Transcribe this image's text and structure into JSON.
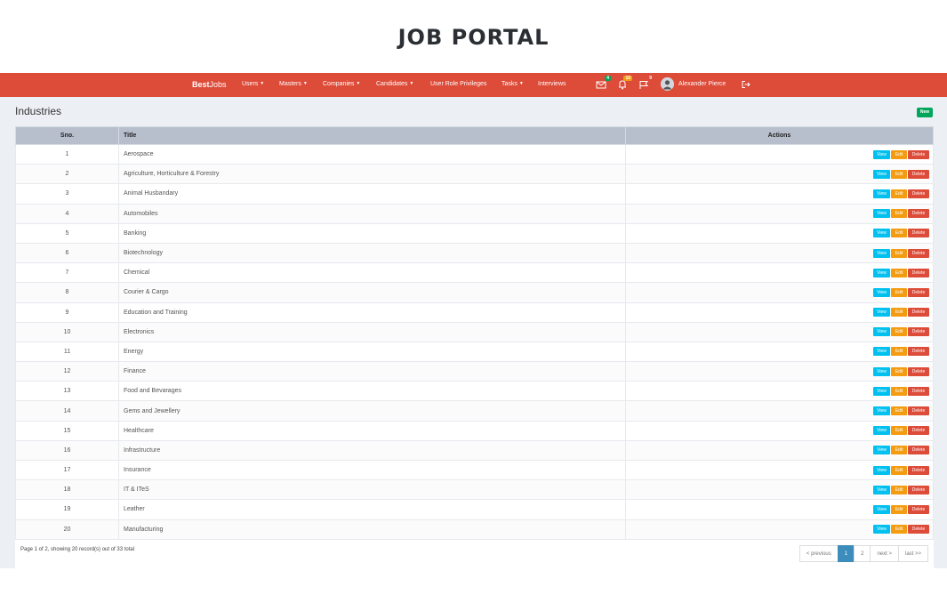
{
  "page_heading": "JOB PORTAL",
  "navbar": {
    "brand_bold": "Best",
    "brand_light": "Jobs",
    "items": [
      {
        "label": "Users",
        "dropdown": true
      },
      {
        "label": "Masters",
        "dropdown": true
      },
      {
        "label": "Companies",
        "dropdown": true
      },
      {
        "label": "Candidates",
        "dropdown": true
      },
      {
        "label": "User Role Privileges",
        "dropdown": false
      },
      {
        "label": "Tasks",
        "dropdown": true
      },
      {
        "label": "Interviews",
        "dropdown": false
      }
    ],
    "mail_badge": "4",
    "bell_badge": "10",
    "flag_badge": "9",
    "user_name": "Alexander Pierce"
  },
  "section": {
    "title": "Industries",
    "new_label": "New"
  },
  "table": {
    "headers": {
      "sno": "Sno.",
      "title": "Title",
      "actions": "Actions"
    },
    "action_labels": {
      "view": "View",
      "edit": "Edit",
      "delete": "Delete"
    },
    "rows": [
      {
        "sno": "1",
        "title": "Aerospace"
      },
      {
        "sno": "2",
        "title": "Agriculture, Horticulture & Forestry"
      },
      {
        "sno": "3",
        "title": "Animal Husbandary"
      },
      {
        "sno": "4",
        "title": "Automobiles"
      },
      {
        "sno": "5",
        "title": "Banking"
      },
      {
        "sno": "6",
        "title": "Biotechnology"
      },
      {
        "sno": "7",
        "title": "Chemical"
      },
      {
        "sno": "8",
        "title": "Courier & Cargo"
      },
      {
        "sno": "9",
        "title": "Education and Training"
      },
      {
        "sno": "10",
        "title": "Electronics"
      },
      {
        "sno": "11",
        "title": "Energy"
      },
      {
        "sno": "12",
        "title": "Finance"
      },
      {
        "sno": "13",
        "title": "Food and Bevarages"
      },
      {
        "sno": "14",
        "title": "Gems and Jewellery"
      },
      {
        "sno": "15",
        "title": "Healthcare"
      },
      {
        "sno": "16",
        "title": "Infrastructure"
      },
      {
        "sno": "17",
        "title": "Insurance"
      },
      {
        "sno": "18",
        "title": "IT & ITeS"
      },
      {
        "sno": "19",
        "title": "Leather"
      },
      {
        "sno": "20",
        "title": "Manufacturing"
      }
    ]
  },
  "footer": {
    "summary": "Page 1 of 2, showing 20 record(s) out of 33 total",
    "pager": [
      {
        "label": "< previous",
        "active": false
      },
      {
        "label": "1",
        "active": true
      },
      {
        "label": "2",
        "active": false
      },
      {
        "label": "next >",
        "active": false
      },
      {
        "label": "last >>",
        "active": false
      }
    ]
  }
}
